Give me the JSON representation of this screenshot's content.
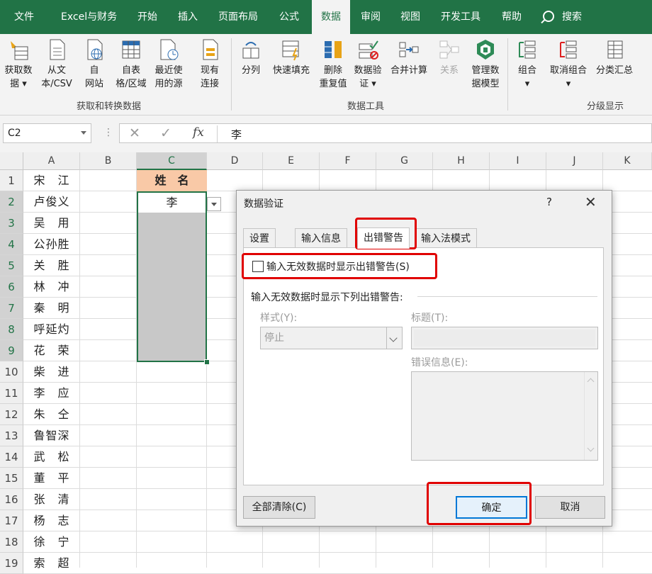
{
  "ribbon": {
    "tabs": [
      "文件",
      "Excel与财务",
      "开始",
      "插入",
      "页面布局",
      "公式",
      "数据",
      "审阅",
      "视图",
      "开发工具",
      "帮助"
    ],
    "active_tab": "数据",
    "search_label": "搜索",
    "groups": {
      "get_transform": {
        "label": "获取和转换数据",
        "buttons": [
          "获取数\n据 ▾",
          "从文\n本/CSV",
          "自\n网站",
          "自表\n格/区域",
          "最近使\n用的源",
          "现有\n连接"
        ]
      },
      "data_tools": {
        "label": "数据工具",
        "buttons": [
          "分列",
          "快速填充",
          "删除\n重复值",
          "数据验\n证 ▾",
          "合并计算",
          "关系",
          "管理数\n据模型"
        ]
      },
      "outline": {
        "label": "分级显示",
        "buttons": [
          "组合\n▾",
          "取消组合\n▾",
          "分类汇总"
        ]
      }
    }
  },
  "formula_bar": {
    "name_box": "C2",
    "cancel_symbol": "✕",
    "enter_symbol": "✓",
    "fx_label": "fx",
    "value": "李"
  },
  "grid": {
    "columns": [
      "A",
      "B",
      "C",
      "D",
      "E",
      "F",
      "G",
      "H",
      "I",
      "J",
      "K"
    ],
    "rows": [
      "1",
      "2",
      "3",
      "4",
      "5",
      "6",
      "7",
      "8",
      "9",
      "10",
      "11",
      "12",
      "13",
      "14",
      "15",
      "16",
      "17",
      "18",
      "19"
    ],
    "column_a": [
      "宋　江",
      "卢俊义",
      "吴　用",
      "公孙胜",
      "关　胜",
      "林　冲",
      "秦　明",
      "呼延灼",
      "花　荣",
      "柴　进",
      "李　应",
      "朱　仝",
      "鲁智深",
      "武　松",
      "董　平",
      "张　清",
      "杨　志",
      "徐　宁",
      "索　超"
    ],
    "c1": "姓　名",
    "c2": "李"
  },
  "dialog": {
    "title": "数据验证",
    "help": "?",
    "close": "✕",
    "tabs": [
      "设置",
      "输入信息",
      "出错警告",
      "输入法模式"
    ],
    "active_tab": "出错警告",
    "checkbox_label": "输入无效数据时显示出错警告(S)",
    "checkbox_checked": false,
    "fieldset_label": "输入无效数据时显示下列出错警告:",
    "style_label": "样式(Y):",
    "style_value": "停止",
    "title_label": "标题(T):",
    "title_value": "",
    "error_msg_label": "错误信息(E):",
    "error_msg_value": "",
    "btn_clear_all": "全部清除(C)",
    "btn_ok": "确定",
    "btn_cancel": "取消"
  },
  "colors": {
    "ribbon_green": "#217346",
    "header_fill": "#f9c9a7",
    "annotation_red": "#e00000",
    "ok_border": "#0078d7"
  }
}
